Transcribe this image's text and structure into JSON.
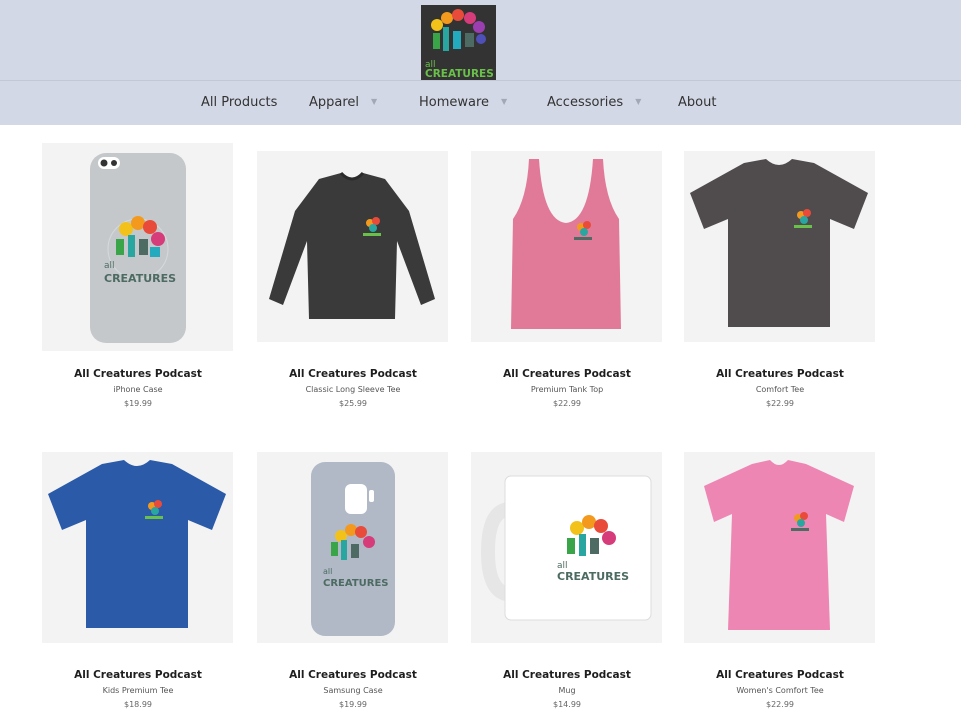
{
  "header": {
    "logo": {
      "small_text": "all",
      "big_text": "CREATURES"
    }
  },
  "nav": {
    "items": [
      {
        "label": "All Products",
        "has_dropdown": false
      },
      {
        "label": "Apparel",
        "has_dropdown": true
      },
      {
        "label": "Homeware",
        "has_dropdown": true
      },
      {
        "label": "Accessories",
        "has_dropdown": true
      },
      {
        "label": "About",
        "has_dropdown": false
      }
    ]
  },
  "products": [
    {
      "name": "All Creatures Podcast",
      "type": "iPhone Case",
      "price": "$19.99",
      "image": "phone-case",
      "color": "#c5c8ca"
    },
    {
      "name": "All Creatures Podcast",
      "type": "Classic Long Sleeve Tee",
      "price": "$25.99",
      "image": "long-sleeve-tee",
      "color": "#3a3a3a"
    },
    {
      "name": "All Creatures Podcast",
      "type": "Premium Tank Top",
      "price": "$22.99",
      "image": "tank-top",
      "color": "#e07a98"
    },
    {
      "name": "All Creatures Podcast",
      "type": "Comfort Tee",
      "price": "$22.99",
      "image": "tee",
      "color": "#504c4d"
    },
    {
      "name": "All Creatures Podcast",
      "type": "Kids Premium Tee",
      "price": "$18.99",
      "image": "tee",
      "color": "#2a5aa8"
    },
    {
      "name": "All Creatures Podcast",
      "type": "Samsung Case",
      "price": "$19.99",
      "image": "samsung-case",
      "color": "#b1b9c7"
    },
    {
      "name": "All Creatures Podcast",
      "type": "Mug",
      "price": "$14.99",
      "image": "mug",
      "color": "#ffffff"
    },
    {
      "name": "All Creatures Podcast",
      "type": "Women's Comfort Tee",
      "price": "$22.99",
      "image": "womens-tee",
      "color": "#ee86b4"
    }
  ]
}
